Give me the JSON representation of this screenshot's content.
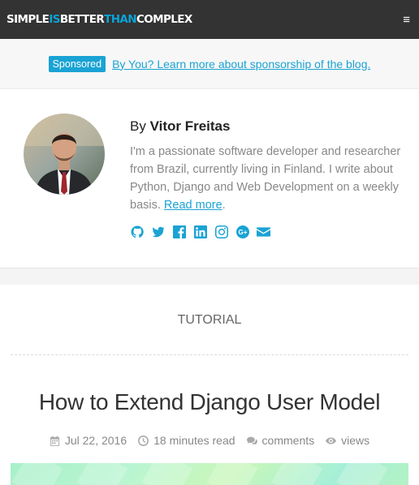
{
  "navbar": {
    "brand_parts": [
      "SIMPLE",
      "IS",
      "BETTER",
      "THAN",
      "COMPLEX"
    ],
    "menu_icon": "≡"
  },
  "sponsor": {
    "badge": "Sponsored",
    "link_text": "By You? Learn more about sponsorship of the blog."
  },
  "author": {
    "by_label": "By",
    "name": "Vitor Freitas",
    "bio": "I'm a passionate software developer and researcher from Brazil, currently living in Finland. I write about Python, Django and Web Development on a weekly basis.",
    "read_more": "Read more",
    "social": [
      "github-icon",
      "twitter-icon",
      "facebook-icon",
      "linkedin-icon",
      "instagram-icon",
      "google-plus-icon",
      "email-icon"
    ]
  },
  "post": {
    "category": "TUTORIAL",
    "title": "How to Extend Django User Model",
    "date": "Jul 22, 2016",
    "read_time": "18 minutes read",
    "comments": "comments",
    "views": "views"
  },
  "colors": {
    "accent": "#1aa3d4",
    "navbar": "#333333"
  }
}
